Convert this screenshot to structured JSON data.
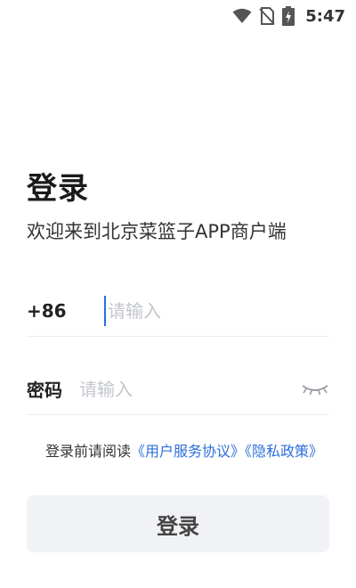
{
  "status_bar": {
    "time": "5:47",
    "icons": [
      "wifi-icon",
      "no-sim-icon",
      "battery-charging-icon"
    ]
  },
  "login": {
    "title": "登录",
    "subtitle": "欢迎来到北京菜篮子APP商户端",
    "phone": {
      "prefix": "+86",
      "placeholder": "请输入",
      "value": ""
    },
    "password": {
      "label": "密码",
      "placeholder": "请输入",
      "value": "",
      "toggle_icon": "eye-closed-icon"
    },
    "agreement": {
      "prefix": "登录前请阅读",
      "user_agreement": "《用户服务协议》",
      "privacy_policy": "《隐私政策》"
    },
    "submit_label": "登录"
  },
  "colors": {
    "accent": "#2b6fd8",
    "button_bg": "#f1f2f5",
    "placeholder": "#c2c6cc"
  }
}
